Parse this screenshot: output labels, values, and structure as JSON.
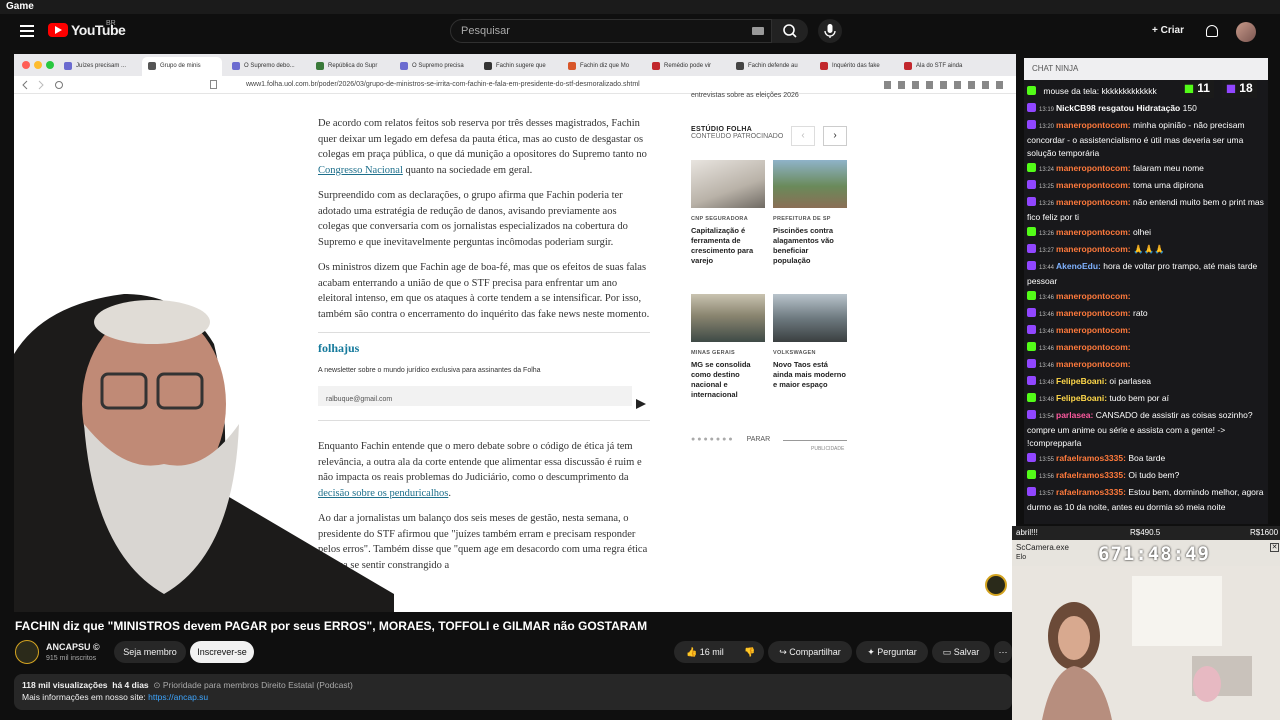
{
  "gamebar": {
    "title": "Game"
  },
  "header": {
    "logo_text": "YouTube",
    "region": "BR",
    "search_placeholder": "Pesquisar",
    "create_label": "Criar"
  },
  "browser": {
    "tabs": [
      "Juízes precisam ...",
      "Grupo de minis",
      "O Supremo debo...",
      "República do Supr",
      "O Supremo precisa",
      "Fachin sugere que",
      "Fachin diz que Mo",
      "Remédio pode vir",
      "Fachin defende au",
      "Inquérito das fake",
      "Ala do STF ainda"
    ],
    "url": "www1.folha.uol.com.br/poder/2026/03/grupo-de-ministros-se-irrita-com-fachin-e-fala-em-presidente-do-stf-desmoralizado.shtml"
  },
  "article": {
    "p1_a": "De acordo com relatos feitos sob reserva por três desses magistrados, Fachin quer deixar um legado em defesa da pauta ética, mas ao custo de desgastar os colegas em praça pública, o que dá munição a opositores do Supremo tanto no ",
    "p1_link": "Congresso Nacional",
    "p1_b": " quanto na sociedade em geral.",
    "p2": "Surpreendido com as declarações, o grupo afirma que Fachin poderia ter adotado uma estratégia de redução de danos, avisando previamente aos colegas que conversaria com os jornalistas especializados na cobertura do Supremo e que inevitavelmente perguntas incômodas poderiam surgir.",
    "p3": "Os ministros dizem que Fachin age de boa-fé, mas que os efeitos de suas falas acabam enterrando a união de que o STF precisa para enfrentar um ano eleitoral intenso, em que os ataques à corte tendem a se intensificar. Por isso, também são contra o encerramento do inquérito das fake news neste momento.",
    "newsletter_title": "folhajus",
    "newsletter_desc": "A newsletter sobre o mundo jurídico exclusiva para assinantes da Folha",
    "newsletter_email": "ralbuque@gmail.com",
    "p4_a": "Enquanto Fachin entende que o mero debate sobre o código de ética já tem relevância, a outra ala da corte entende que alimentar essa discussão é ruim e não impacta os reais problemas do Judiciário, como o descumprimento da ",
    "p4_link": "decisão sobre os penduricalhos",
    "p4_b": ".",
    "p5": "Ao dar a jornalistas um balanço dos seis meses de gestão, nesta semana, o presidente do STF afirmou que \"juízes também erram e precisam responder pelos erros\". Também disse que \"quem age em desacordo com uma regra ética precisa se sentir constrangido a"
  },
  "sidebar": {
    "top_text": "entrevistas sobre as eleições 2026",
    "section_title": "ESTÚDIO FOLHA",
    "section_sub": "CONTEÚDO PATROCINADO",
    "cards": [
      {
        "tag": "CNP SEGURADORA",
        "title": "Capitalização é ferramenta de crescimento para varejo"
      },
      {
        "tag": "PREFEITURA DE SP",
        "title": "Piscinões contra alagamentos vão beneficiar população"
      },
      {
        "tag": "MINAS GERAIS",
        "title": "MG se consolida como destino nacional e internacional"
      },
      {
        "tag": "VOLKSWAGEN",
        "title": "Novo Taos está ainda mais moderno e maior espaço"
      }
    ],
    "pause_label": "PARAR",
    "ad_label": "PUBLICIDADE"
  },
  "video": {
    "title": "FACHIN diz que \"MINISTROS devem PAGAR por seus ERROS\", MORAES, TOFFOLI e GILMAR não GOSTARAM",
    "channel_name": "ANCAPSU ©",
    "subscribers": "915 mil inscritos",
    "member_label": "Seja membro",
    "subscribe_label": "Inscrever-se",
    "likes": "16 mil",
    "share_label": "Compartilhar",
    "ask_label": "Perguntar",
    "save_label": "Salvar",
    "views": "118 mil visualizações",
    "age": "há 4 dias",
    "tags": "⊙ Prioridade para membros  Direito Estatal (Podcast)",
    "more_info": "Mais informações em nosso site: ",
    "site_link": "https://ancap.su"
  },
  "chat": {
    "header": "CHAT NINJA",
    "count_a": "11",
    "count_b": "18",
    "messages": [
      {
        "time": "",
        "user": "",
        "text": "mouse da tela: kkkkkkkkkkkkk",
        "color": "#fff"
      },
      {
        "time": "13:19",
        "user": "NickCB98 resgatou Hidratação",
        "text": "150",
        "color": "#fff"
      },
      {
        "time": "13:20",
        "user": "maneropontocom:",
        "text": "minha opinião - não precisam concordar - o assistencialismo é útil mas deveria ser uma solução temporária",
        "color": "#ff7a3c"
      },
      {
        "time": "13:24",
        "user": "maneropontocom:",
        "text": "falaram meu nome",
        "color": "#ff7a3c"
      },
      {
        "time": "13:25",
        "user": "maneropontocom:",
        "text": "toma uma dipirona",
        "color": "#ff7a3c"
      },
      {
        "time": "13:26",
        "user": "maneropontocom:",
        "text": "não entendi muito bem o print mas fico feliz por ti",
        "color": "#ff7a3c"
      },
      {
        "time": "13:26",
        "user": "maneropontocom:",
        "text": "olhei",
        "color": "#ff7a3c"
      },
      {
        "time": "13:27",
        "user": "maneropontocom:",
        "text": "🙏🙏🙏",
        "color": "#ff7a3c"
      },
      {
        "time": "13:44",
        "user": "AkenoEdu:",
        "text": "hora de voltar pro trampo, até mais tarde pessoar",
        "color": "#7fb2ff"
      },
      {
        "time": "13:46",
        "user": "maneropontocom:",
        "text": "",
        "color": "#ff7a3c"
      },
      {
        "time": "13:46",
        "user": "maneropontocom:",
        "text": "rato",
        "color": "#ff7a3c"
      },
      {
        "time": "13:46",
        "user": "maneropontocom:",
        "text": "",
        "color": "#ff7a3c"
      },
      {
        "time": "13:46",
        "user": "maneropontocom:",
        "text": "",
        "color": "#ff7a3c"
      },
      {
        "time": "13:46",
        "user": "maneropontocom:",
        "text": "",
        "color": "#ff7a3c"
      },
      {
        "time": "13:48",
        "user": "FelipeBoani:",
        "text": "oi parlasea",
        "color": "#ffd84a"
      },
      {
        "time": "13:48",
        "user": "FelipeBoani:",
        "text": "tudo bem por aí",
        "color": "#ffd84a"
      },
      {
        "time": "13:54",
        "user": "parlasea:",
        "text": "CANSADO de assistir as coisas sozinho? compre um anime ou série e assista com a gente! -> !comprepparla",
        "color": "#ff5aa0"
      },
      {
        "time": "13:55",
        "user": "rafaelramos3335:",
        "text": "Boa tarde",
        "color": "#ff7a3c"
      },
      {
        "time": "13:56",
        "user": "rafaelramos3335:",
        "text": "Oi tudo bem?",
        "color": "#ff7a3c"
      },
      {
        "time": "13:57",
        "user": "rafaelramos3335:",
        "text": "Estou bem, dormindo melhor, agora durmo as 10 da noite, antes eu dormia só meia noite",
        "color": "#ff7a3c"
      }
    ]
  },
  "overlay": {
    "label_left": "abril!!!",
    "label_mid": "R$490.5",
    "label_right": "R$1600",
    "window_title": "ScCamera.exe",
    "window_sub": "Elo",
    "timer": "671:48:49"
  }
}
